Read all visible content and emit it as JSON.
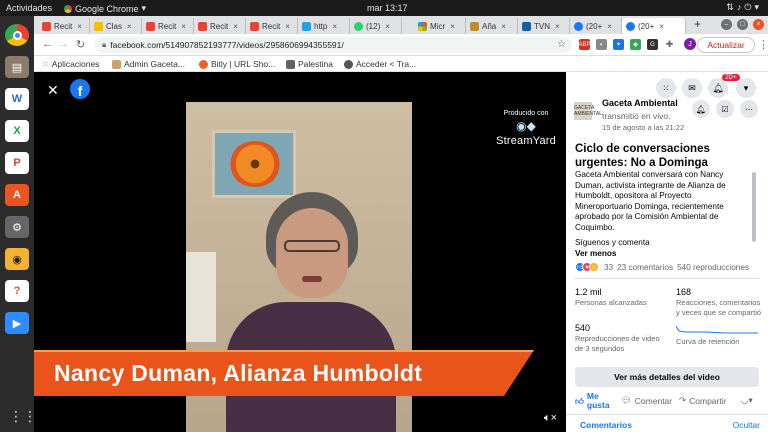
{
  "system": {
    "activities": "Actividades",
    "app_name": "Google Chrome",
    "clock": "mar 13:17"
  },
  "tabs": [
    {
      "label": "Recit",
      "color": "#ea4335"
    },
    {
      "label": "Clas",
      "color": "#fbbc04"
    },
    {
      "label": "Recit",
      "color": "#ea4335"
    },
    {
      "label": "Recit",
      "color": "#ea4335"
    },
    {
      "label": "Recit",
      "color": "#ea4335"
    },
    {
      "label": "http",
      "color": "#1da1f2"
    },
    {
      "label": "(12)",
      "color": "#25d366"
    },
    {
      "label": "Micr",
      "color": "#888888"
    },
    {
      "label": "Aña",
      "color": "#c58b2a"
    },
    {
      "label": "TVN",
      "color": "#0e61a6"
    },
    {
      "label": "(20+",
      "color": "#1877f2"
    },
    {
      "label": "(20+",
      "color": "#1877f2"
    }
  ],
  "newtab": "+",
  "address": {
    "url": "facebook.com/514907852193777/videos/2958606994355591/",
    "update_button": "Actualizar",
    "profile": "J"
  },
  "bookmarks": [
    {
      "label": "Aplicaciones"
    },
    {
      "label": "Admin Gaceta..."
    },
    {
      "label": "Bitly | URL Sho..."
    },
    {
      "label": "Palestina"
    },
    {
      "label": "Acceder < Tra..."
    }
  ],
  "video": {
    "producer_caption": "Producido con",
    "producer_name": "StreamYard",
    "lower_third": "Nancy Duman, Alianza Humboldt"
  },
  "post": {
    "notif_badge": "20+",
    "page_name": "Gaceta Ambiental",
    "page_thumb_text": "GACETA AMBIENTAL",
    "action": "transmitió en vivo.",
    "date": "15 de agosto a las 21:22",
    "title": "Ciclo de conversaciones urgentes: No a Dominga",
    "description": "Gaceta Ambiental conversará con Nancy Duman, activista integrante de Alianza de Humboldt, opositora al Proyecto Mineroportuario Dominga, recientemente aprobado por la Comisión Ambiental de Coquimbo.",
    "follow": "Síguenos y comenta",
    "see_more": "Ver menos",
    "reactions_count": "33",
    "comments_count": "23 comentarios",
    "views_count": "540 reproducciones",
    "stats": {
      "reach_value": "1.2 mil",
      "reach_label": "Personas alcanzadas",
      "interactions_value": "168",
      "interactions_label": "Reacciones, comentarios y veces que se compartió",
      "plays_value": "540",
      "plays_label": "Reproducciones de video de 3 segundos",
      "retention_label": "Curva de retención"
    },
    "more_details": "Ver más detalles del video",
    "like": "Me gusta",
    "comment": "Comentar",
    "share": "Compartir",
    "comments_tab": "Comentarios",
    "comments_sort": "Ocultar"
  }
}
